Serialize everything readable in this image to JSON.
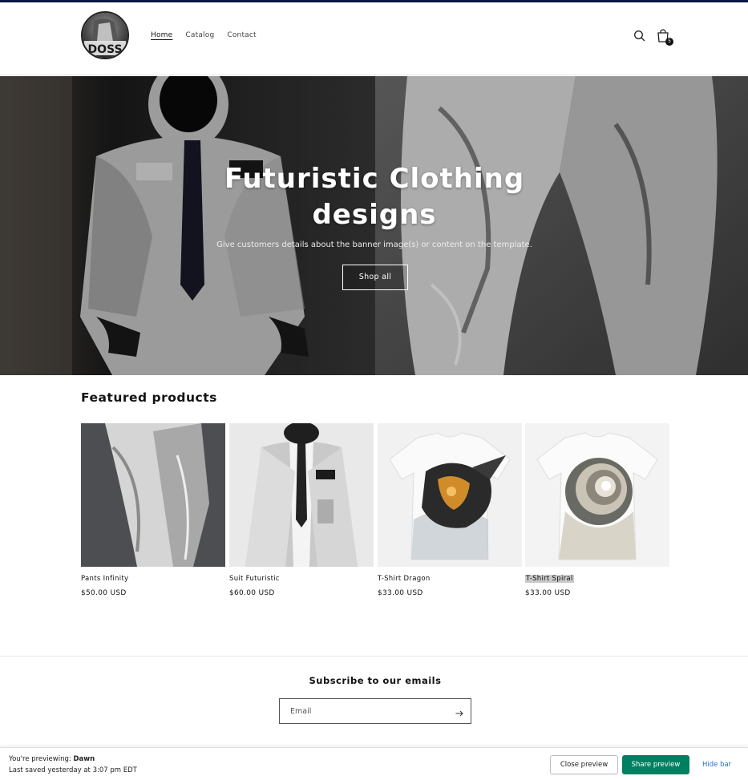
{
  "brand": {
    "logo_text": "DOSS"
  },
  "nav": {
    "items": [
      {
        "label": "Home",
        "active": true
      },
      {
        "label": "Catalog"
      },
      {
        "label": "Contact"
      }
    ]
  },
  "header": {
    "search_icon": "search-icon",
    "cart_icon": "shopping-bag-icon",
    "cart_count": "5"
  },
  "hero": {
    "title": "Futuristic Clothing designs",
    "subtitle": "Give customers details about the banner image(s) or content on the template.",
    "button_label": "Shop all"
  },
  "featured": {
    "title": "Featured products",
    "products": [
      {
        "name": "Pants Infinity",
        "price": "$50.00 USD"
      },
      {
        "name": "Suit Futuristic",
        "price": "$60.00 USD"
      },
      {
        "name": "T-Shirt Dragon",
        "price": "$33.00 USD"
      },
      {
        "name": "T-Shirt Spiral",
        "price": "$33.00 USD"
      }
    ]
  },
  "subscribe": {
    "title": "Subscribe to our emails",
    "email_placeholder": "Email",
    "submit_icon": "arrow-right-icon"
  },
  "preview_bar": {
    "previewing_prefix": "You're previewing: ",
    "theme_name": "Dawn",
    "last_saved": "Last saved yesterday at 3:07 pm EDT",
    "close_label": "Close preview",
    "share_label": "Share preview",
    "hide_label": "Hide bar"
  },
  "colors": {
    "topline": "#0d1440",
    "share_button": "#008060",
    "link": "#2c6ecb"
  }
}
